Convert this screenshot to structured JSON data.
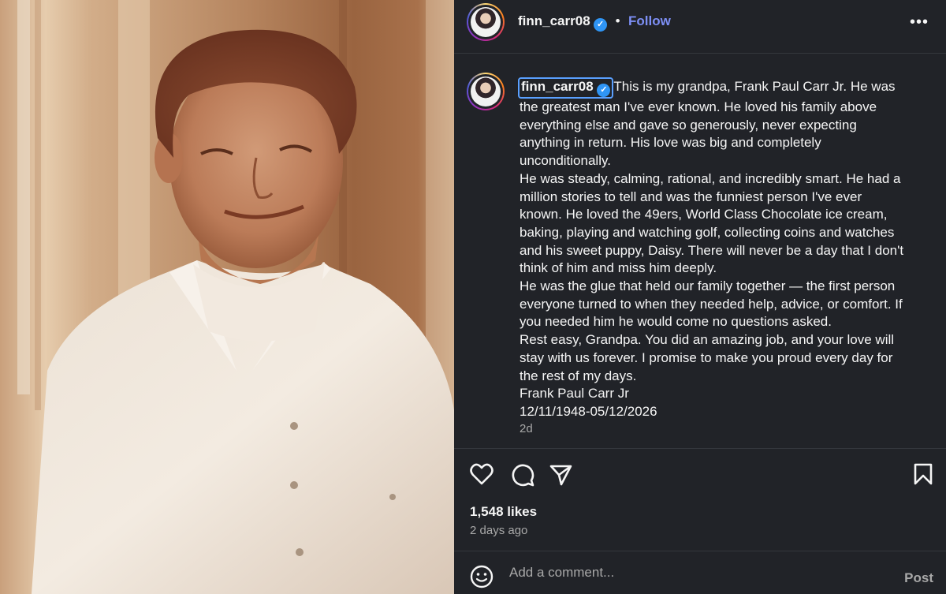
{
  "post": {
    "username": "finn_carr08",
    "follow_label": "Follow",
    "separator": "•",
    "more_icon": "more-horizontal-icon"
  },
  "caption": {
    "username": "finn_carr08",
    "lines": [
      "This is my grandpa, Frank Paul Carr Jr. He was",
      "the greatest man I've ever known. He loved his family above",
      "everything else and gave so generously, never expecting",
      "anything in return. His love was big and completely",
      "unconditionally.",
      "He was steady, calming, rational, and incredibly smart. He had a",
      "million stories to tell and was the funniest person I've ever",
      "known. He loved the 49ers, World Class Chocolate ice cream,",
      "baking, playing and watching golf, collecting coins and watches",
      "and his sweet puppy, Daisy. There will never be a day that I don't",
      "think of him and miss him deeply.",
      "He was the glue that held our family together — the first person",
      "everyone turned to when they needed help, advice, or comfort. If",
      "you needed him he would come no questions asked.",
      "Rest easy, Grandpa. You did an amazing job, and your love will",
      "stay with us forever. I promise to make you proud every day for",
      "the rest of my days.",
      "Frank Paul Carr Jr",
      "12/11/1948-05/12/2026"
    ],
    "time_ago": "2d"
  },
  "engagement": {
    "likes": "1,548 likes",
    "date": "2 days ago"
  },
  "comment": {
    "placeholder": "Add a comment...",
    "post_label": "Post"
  },
  "colors": {
    "background": "#212328",
    "follow": "#7d8ff5",
    "verified": "#2f95f5",
    "muted": "#a8a8a8"
  }
}
